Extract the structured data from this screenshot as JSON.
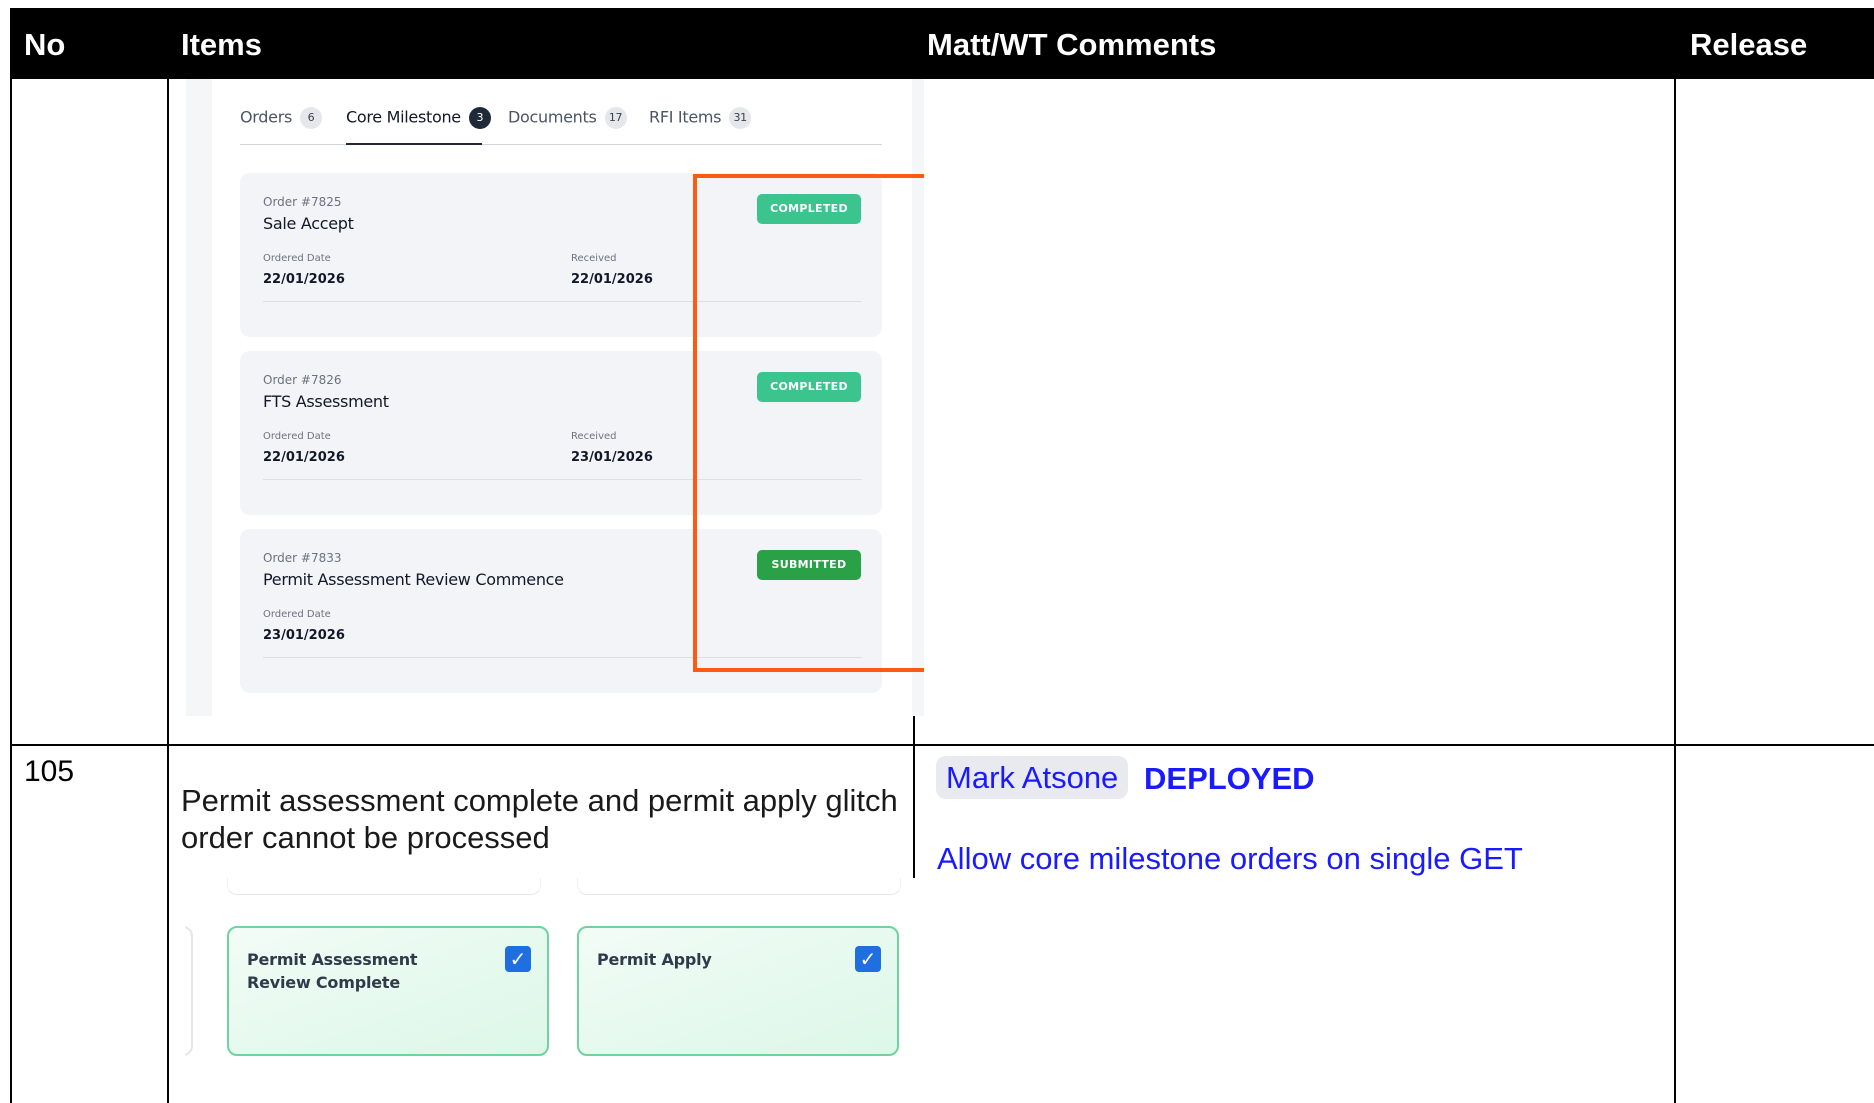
{
  "header": {
    "no": "No",
    "items": "Items",
    "comments": "Matt/WT Comments",
    "release": "Release"
  },
  "row1": {
    "screenshot": {
      "tabs": [
        {
          "label": "Orders",
          "count": "6",
          "active": false
        },
        {
          "label": "Core Milestone",
          "count": "3",
          "active": true
        },
        {
          "label": "Documents",
          "count": "17",
          "active": false
        },
        {
          "label": "RFI Items",
          "count": "31",
          "active": false
        }
      ],
      "orders": [
        {
          "order_no": "Order #7825",
          "title": "Sale Accept",
          "ordered_label": "Ordered Date",
          "ordered": "22/01/2026",
          "received_label": "Received",
          "received": "22/01/2026",
          "status": "COMPLETED",
          "status_color": "#3cc48f"
        },
        {
          "order_no": "Order #7826",
          "title": "FTS Assessment",
          "ordered_label": "Ordered Date",
          "ordered": "22/01/2026",
          "received_label": "Received",
          "received": "23/01/2026",
          "status": "COMPLETED",
          "status_color": "#3cc48f"
        },
        {
          "order_no": "Order #7833",
          "title": "Permit Assessment Review Commence",
          "ordered_label": "Ordered Date",
          "ordered": "23/01/2026",
          "status": "SUBMITTED",
          "status_color": "#2aa147"
        }
      ]
    }
  },
  "row2": {
    "no": "105",
    "description": "Permit assessment complete and permit apply glitch order cannot be processed",
    "screenshot": {
      "cards": [
        {
          "title": "Permit Assessment Review Complete",
          "checked": true
        },
        {
          "title": "Permit Apply",
          "checked": true
        }
      ],
      "check_glyph": "✓"
    },
    "mention": "Mark Atsone",
    "status": "DEPLOYED",
    "comment": "Allow core milestone orders on single GET"
  },
  "colors": {
    "header_bg": "#000000",
    "link_blue": "#1a1aff",
    "highlight_box": "#ff5a14"
  }
}
